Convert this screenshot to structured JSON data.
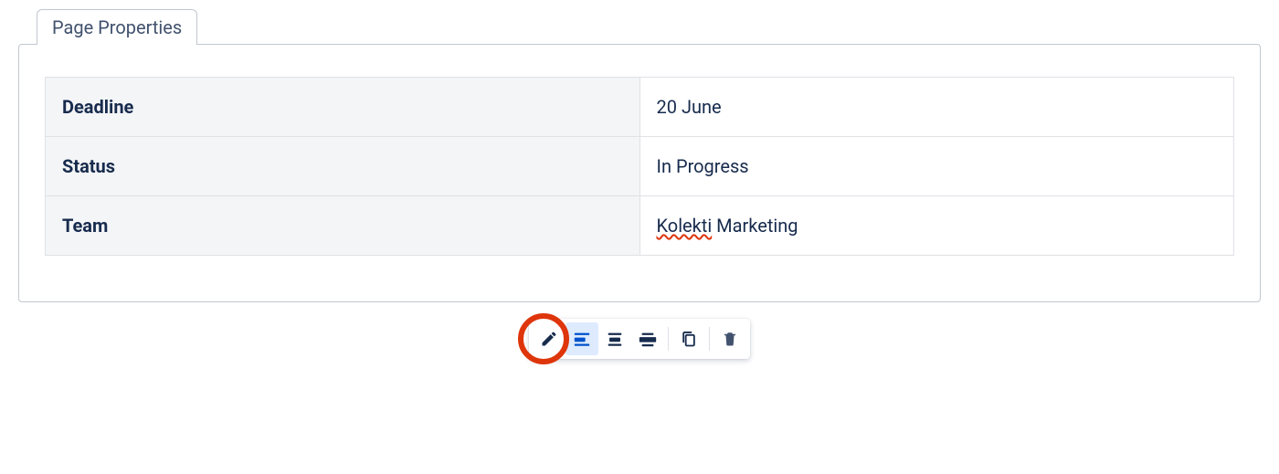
{
  "tab": {
    "label": "Page Properties"
  },
  "properties": {
    "rows": [
      {
        "label": "Deadline",
        "value": "20 June",
        "spellcheck_word": null
      },
      {
        "label": "Status",
        "value": "In Progress",
        "spellcheck_word": null
      },
      {
        "label": "Team",
        "value": "Kolekti Marketing",
        "spellcheck_word": "Kolekti"
      }
    ]
  },
  "toolbar": {
    "edit": "Edit",
    "align_left": "Align left",
    "align_center": "Align center",
    "align_wide": "Full width",
    "copy": "Copy",
    "delete": "Delete"
  }
}
